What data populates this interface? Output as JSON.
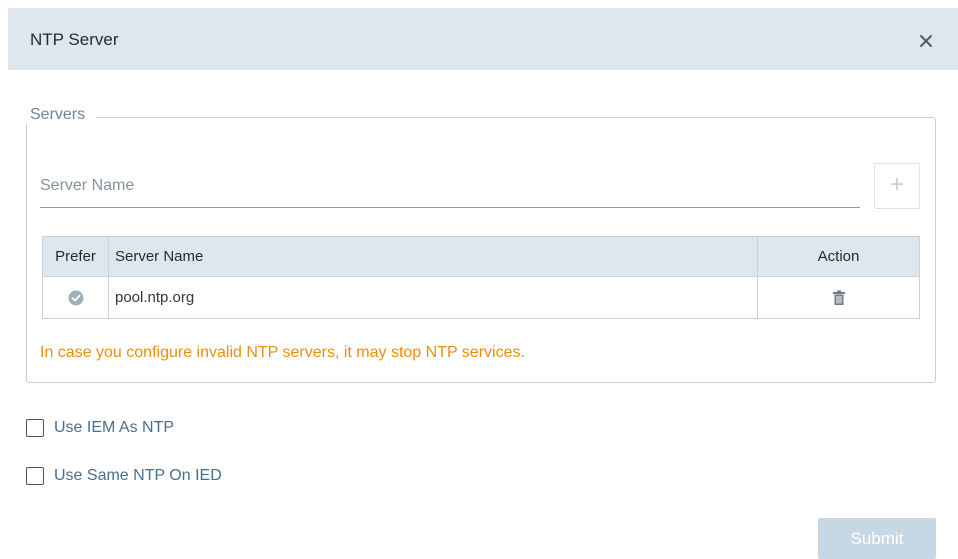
{
  "dialog": {
    "title": "NTP Server",
    "close_icon": "close-icon"
  },
  "servers": {
    "legend": "Servers",
    "input_placeholder": "Server Name",
    "input_value": "",
    "add_icon": "plus-icon",
    "table": {
      "headers": {
        "prefer": "Prefer",
        "server_name": "Server Name",
        "action": "Action"
      },
      "rows": [
        {
          "preferred": true,
          "server_name": "pool.ntp.org",
          "action_icon": "trash-icon"
        }
      ]
    },
    "warning": "In case you configure invalid NTP servers, it may stop NTP services."
  },
  "options": {
    "use_iem_as_ntp": {
      "label": "Use IEM As NTP",
      "checked": false
    },
    "use_same_ntp_on_ied": {
      "label": "Use Same NTP On IED",
      "checked": false
    }
  },
  "footer": {
    "submit_label": "Submit"
  },
  "colors": {
    "header_bg": "#dfe6ed",
    "warning": "#e8900e",
    "link_label": "#4a6f8c",
    "submit_disabled": "#c5d8e4"
  }
}
